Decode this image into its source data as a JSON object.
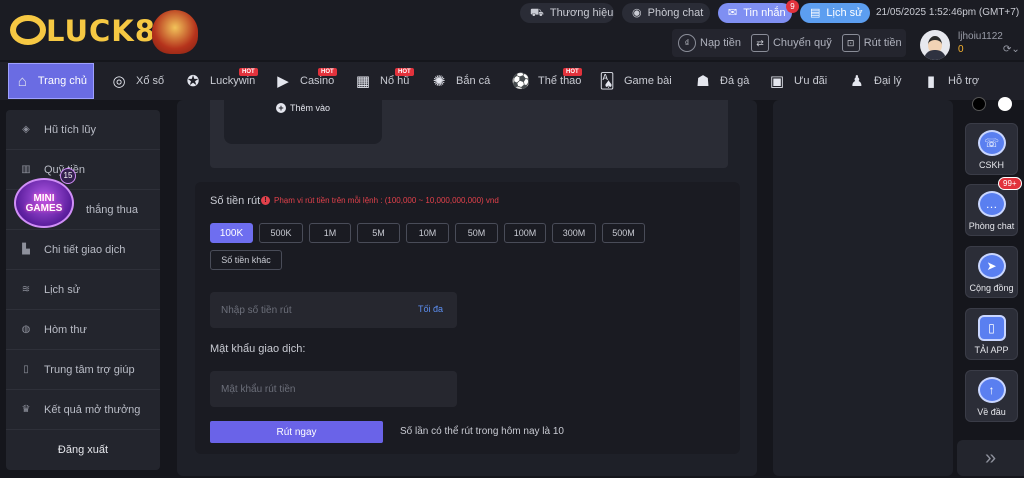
{
  "brand": {
    "logo_text": "LUCK8"
  },
  "header": {
    "links": [
      {
        "label": "Thương hiệu",
        "icon": "car-icon"
      },
      {
        "label": "Phòng chat",
        "icon": "chat-icon"
      },
      {
        "label": "Tin nhắn",
        "icon": "mail-icon",
        "badge": "9"
      },
      {
        "label": "Lịch sử",
        "icon": "history-icon"
      }
    ],
    "datetime": "21/05/2025 1:52:46pm",
    "timezone": "(GMT+7)",
    "wallet": [
      {
        "label": "Nạp tiền",
        "icon": "deposit-icon"
      },
      {
        "label": "Chuyển quỹ",
        "icon": "transfer-icon"
      },
      {
        "label": "Rút tiền",
        "icon": "withdraw-icon"
      }
    ],
    "user": {
      "name": "ljhoiu1122",
      "balance": "0"
    }
  },
  "nav": {
    "hot_label": "HOT",
    "items": [
      {
        "label": "Trang chủ",
        "icon": "home-icon",
        "active": true
      },
      {
        "label": "Xổ số",
        "icon": "lottery-icon"
      },
      {
        "label": "Luckywin",
        "icon": "luckywin-icon",
        "hot": true
      },
      {
        "label": "Casino",
        "icon": "casino-icon",
        "hot": true
      },
      {
        "label": "Nổ hũ",
        "icon": "slot-icon",
        "hot": true
      },
      {
        "label": "Bắn cá",
        "icon": "fish-icon"
      },
      {
        "label": "Thể thao",
        "icon": "soccer-icon",
        "hot": true
      },
      {
        "label": "Game bài",
        "icon": "cards-icon"
      },
      {
        "label": "Đá gà",
        "icon": "rooster-icon"
      },
      {
        "label": "Ưu đãi",
        "icon": "gift-icon"
      },
      {
        "label": "Đại lý",
        "icon": "agent-icon"
      },
      {
        "label": "Hỗ trợ",
        "icon": "support-icon"
      }
    ]
  },
  "sidebar": {
    "items": [
      {
        "label": "Hũ tích lũy",
        "icon": "jar-icon"
      },
      {
        "label": "Quỹ tiền",
        "icon": "fund-icon"
      },
      {
        "label": "thắng thua",
        "icon": "chart-icon"
      },
      {
        "label": "Chi tiết giao dịch",
        "icon": "bars-icon"
      },
      {
        "label": "Lịch sử",
        "icon": "coins-icon"
      },
      {
        "label": "Hòm thư",
        "icon": "mailbox-icon"
      },
      {
        "label": "Trung tâm trợ giúp",
        "icon": "book-icon"
      },
      {
        "label": "Kết quả mở thưởng",
        "icon": "trophy-icon"
      }
    ],
    "logout": "Đăng xuất"
  },
  "mini_games": {
    "line1": "MINI",
    "line2": "GAMES",
    "count": "15"
  },
  "bank": {
    "add_label": "Thêm vào"
  },
  "withdraw": {
    "amount_label": "Số tiền rút",
    "range_note": "Phạm vi rút tiền trên mỗi lệnh : (100,000 ~ 10,000,000,000) vnd",
    "amounts": [
      "100K",
      "500K",
      "1M",
      "5M",
      "10M",
      "50M",
      "100M",
      "300M",
      "500M"
    ],
    "selected_amount": "100K",
    "other_amount": "Số tiền khác",
    "amount_placeholder": "Nhập số tiền rút",
    "max_label": "Tối đa",
    "password_label": "Mật khẩu giao dịch:",
    "password_placeholder": "Mật khẩu rút tiền",
    "submit_label": "Rút ngay",
    "quota_text": "Số lần có thể rút trong hôm nay là 10"
  },
  "float": {
    "items": [
      {
        "label": "CSKH",
        "icon": "headset-icon"
      },
      {
        "label": "Phòng chat",
        "icon": "chat-bubble-icon",
        "badge": "99+"
      },
      {
        "label": "Cộng đồng",
        "icon": "send-icon"
      },
      {
        "label": "TẢI APP",
        "icon": "phone-icon"
      },
      {
        "label": "Về đầu",
        "icon": "arrow-up-icon"
      }
    ]
  },
  "colors": {
    "accent": "#6a6ce3",
    "danger": "#e2323c",
    "gold": "#f6c843"
  }
}
